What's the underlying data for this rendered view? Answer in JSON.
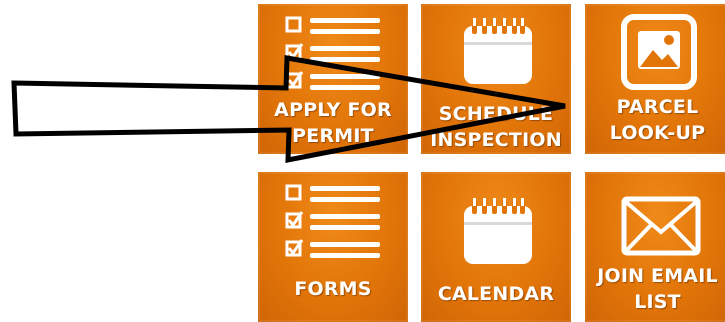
{
  "tiles": {
    "apply_permit": {
      "line1": "APPLY FOR",
      "line2": "PERMIT",
      "icon": "checklist-icon"
    },
    "schedule_inspection": {
      "line1": "SCHEDULE",
      "line2": "INSPECTION",
      "icon": "calendar-icon"
    },
    "parcel_lookup": {
      "line1": "PARCEL",
      "line2": "LOOK-UP",
      "icon": "image-icon"
    },
    "forms": {
      "line1": "FORMS",
      "icon": "checklist-icon"
    },
    "calendar": {
      "line1": "CALENDAR",
      "icon": "calendar-icon"
    },
    "join_email": {
      "line1": "JOIN EMAIL",
      "line2": "LIST",
      "icon": "envelope-icon"
    }
  },
  "annotation": {
    "icon": "right-arrow-outline-icon"
  },
  "colors": {
    "tile_orange": "#e27508",
    "icon_white": "#ffffff",
    "arrow_stroke": "#000000"
  }
}
